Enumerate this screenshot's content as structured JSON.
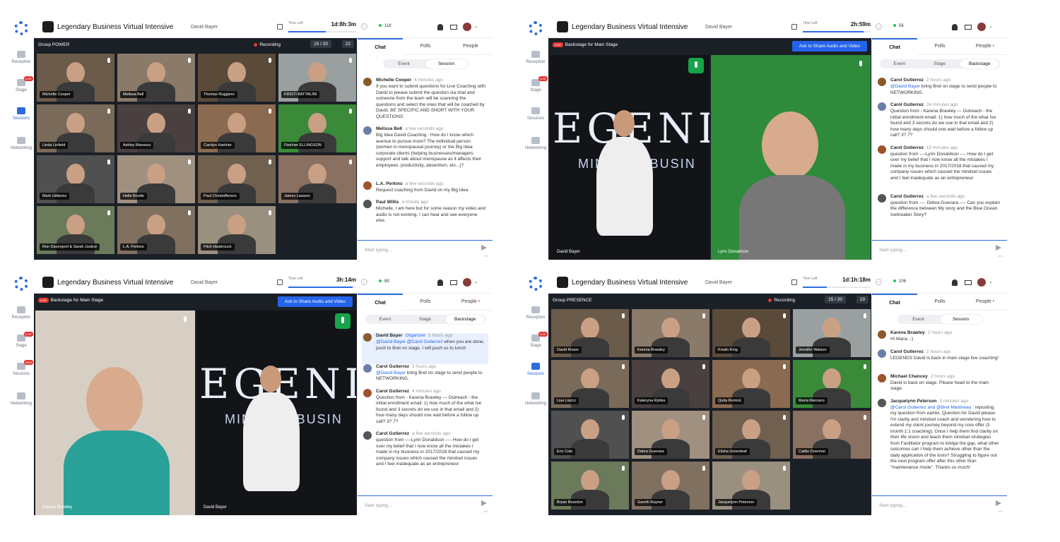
{
  "event": {
    "title": "Legendary Business Virtual Intensive",
    "host": "David Bayer",
    "timer_label": "Time Left"
  },
  "rail": {
    "reception": "Reception",
    "stage": "Stage",
    "sessions": "Sessions",
    "networking": "Networking",
    "live_badge": "LIVE",
    "new_badge": "NEW"
  },
  "composer": {
    "placeholder": "Start typing...",
    "limit": "500"
  },
  "colors": {
    "accent": "#2d6cdf",
    "live": "#e53935",
    "online": "#22c55e",
    "button": "#2563eb"
  },
  "panels": [
    {
      "timer": "1d:8h:3m",
      "timer_fill": 0.55,
      "online": "118",
      "stage_label": "Group POWER",
      "recording": "Recording",
      "count": "15 / 20",
      "viewers": "22",
      "tabs": [
        "Chat",
        "Polls",
        "People"
      ],
      "segments": [
        "Event",
        "Session"
      ],
      "active_segment": 1,
      "tiles": [
        "Michelle Cooper",
        "Melissa Bell",
        "Thomas Ruggiero",
        "KRISTI BATTALINI",
        "Linda Linfield",
        "Ashley Mansour",
        "Carolyn Hartzler",
        "Fletcher ELLINGSON",
        "Mark Gibbons",
        "Helle Brodie",
        "Paul Christofferson",
        "James Lawson",
        "Ron Davenport & Sarah Justice",
        "L.A. Perkins",
        "Fitch Hasbrouck"
      ],
      "messages": [
        {
          "name": "Michelle Cooper",
          "time": "4 minutes ago",
          "text": "If you want to submit questions for Live Coaching with David to please submit the question via chat and someone from the team will be scanning the questions and select the ones that will be coached by David. BE SPECIFIC AND SHORT WITH YOUR QUESTIONS"
        },
        {
          "name": "Melissa Bell",
          "time": "a few seconds ago",
          "text": "Big Idea David Coaching : How do I know which avenue to pursue more? The individual person (women in menopausal journey) or the Big Idea corporate clients (helping businesses/managers support and talk about menopause as it affects their employees, productivity, absentism, etc...)?"
        },
        {
          "name": "L.A. Perkins",
          "time": "a few seconds ago",
          "text": "Request coaching from David on my Big Idea"
        },
        {
          "name": "Paul Willis",
          "time": "a minute ago",
          "text": "Michelle, I am here but for some reason my video and audio is not working. I can hear and see everyone else."
        }
      ]
    },
    {
      "timer": "2h:59m",
      "timer_fill": 0.9,
      "online": "56",
      "stage_label": "Backstage for Main Stage",
      "ask_button": "Ask to Share Audio and Video",
      "tabs": [
        "Chat",
        "Polls",
        "People"
      ],
      "segments": [
        "Event",
        "Stage",
        "Backstage"
      ],
      "active_segment": 2,
      "videos": [
        "David Bayer",
        "Lynn Donaldson"
      ],
      "slide": {
        "big": "EGENI",
        "small": "MINDSET BUSIN"
      },
      "messages": [
        {
          "name": "Carol Gutierrez",
          "time": "2 hours ago",
          "mention": "@David Bayer",
          "text": "bring Bret on stage to send people to NETWORKING."
        },
        {
          "name": "Carol Gutierrez",
          "time": "24 minutes ago",
          "text": "Question from - Karena Brawley --- Outreach - the initial enrollment email: 1) how much of the what Ive found and 3 secrets do we use in that email and 2) how many days should one wait before a follow up call? 3? 7?"
        },
        {
          "name": "Carol Gutierrez",
          "time": "15 minutes ago",
          "text": "question from ----Lynn Donaldson ---- How do I get over my belief that I now know all the mistakes I made in my business in 2017/2018 that caused my company issues which caused the mindset issues and I feel inadequate as an entrepreneur"
        },
        {
          "name": "Carol Gutierrez",
          "time": "a few seconds ago",
          "text": "question from ---- Debra Guevara ---- Can you explain the difference between My story and the Blue Ocean Icebreaker Story?"
        }
      ]
    },
    {
      "timer": "3h:14m",
      "timer_fill": 0.95,
      "online": "89",
      "stage_label": "Backstage for Main Stage",
      "ask_button": "Ask to Share Audio and Video",
      "tabs": [
        "Chat",
        "Polls",
        "People"
      ],
      "segments": [
        "Event",
        "Stage",
        "Backstage"
      ],
      "active_segment": 2,
      "videos": [
        "Karena Brawley",
        "David Bayer"
      ],
      "slide": {
        "big": "EGENI",
        "small": "MINDSET BUSIN"
      },
      "messages": [
        {
          "name": "David Bayer",
          "role": "Organizer",
          "time": "5 hours ago",
          "mention": "@David Bayer @Carol Gutierrez",
          "text": "when you are done, push to Bret on stage, I will push us to lunch"
        },
        {
          "name": "Carol Gutierrez",
          "time": "2 hours ago",
          "mention": "@David Bayer",
          "text": "bring Bret on stage to send people to NETWORKING."
        },
        {
          "name": "Carol Gutierrez",
          "time": "4 minutes ago",
          "text": "Question from - Karena Brawley --- Outreach - the initial enrollment email: 1) how much of the what Ive found and 3 secrets do we use in that email and 2) how many days should one wait before a follow up call? 3? 7?"
        },
        {
          "name": "Carol Gutierrez",
          "time": "a few seconds ago",
          "text": "question from ----Lynn Donaldson ---- How do I get over my belief that I now know all the mistakes I made in my business in 2017/2018 that caused my company issues which caused the mindset issues and I feel inadequate as an entrepreneur"
        }
      ]
    },
    {
      "timer": "1d:1h:18m",
      "timer_fill": 0.35,
      "online": "106",
      "stage_label": "Group PRESENCE",
      "recording": "Recording",
      "count": "15 / 20",
      "viewers": "19",
      "tabs": [
        "Chat",
        "Polls",
        "People"
      ],
      "segments": [
        "Event",
        "Session"
      ],
      "active_segment": 1,
      "tiles": [
        "David Kloser",
        "Karena Brawley",
        "Kristin King",
        "Jennifer Watson",
        "Lisa Liszcz",
        "Kateryna Rybka",
        "Quita Remick",
        "Maria Marcano",
        "Eric Cole",
        "Debra Guevara",
        "Elisha Greenleaf",
        "Caitlin Doermer",
        "Bryan Bourdon",
        "Gareth Rayner",
        "Jacquelynn Peterson"
      ],
      "messages": [
        {
          "name": "Karena Brawley",
          "time": "2 hours ago",
          "text": "Hi Maria :-)"
        },
        {
          "name": "Carol Gutierrez",
          "time": "2 hours ago",
          "text": "LEGENDS David is back in main stage live coaching!"
        },
        {
          "name": "Michael Chancey",
          "time": "2 hours ago",
          "text": "David is back on stage. Please head to the main stage."
        },
        {
          "name": "Jacquelynn Peterson",
          "time": "3 minutes ago",
          "mention": "@Carol Gutierrez and @Bret Martineau :",
          "text": "reposting my question from earlier. Question for David please: I'm clarity and mindset coach and wondering how to extend my client journey beyond my core offer (3 month 1:1 coaching). Once I help them find clarity on their life vision and teach them mindset strategies from Facilitator program to bridge the gap, what other outcomes can I help them achieve other than the daily application of the tools? Struggling to figure out the next program offer after this other than \"maintenance mode\". Thanks so much!"
        }
      ]
    }
  ]
}
